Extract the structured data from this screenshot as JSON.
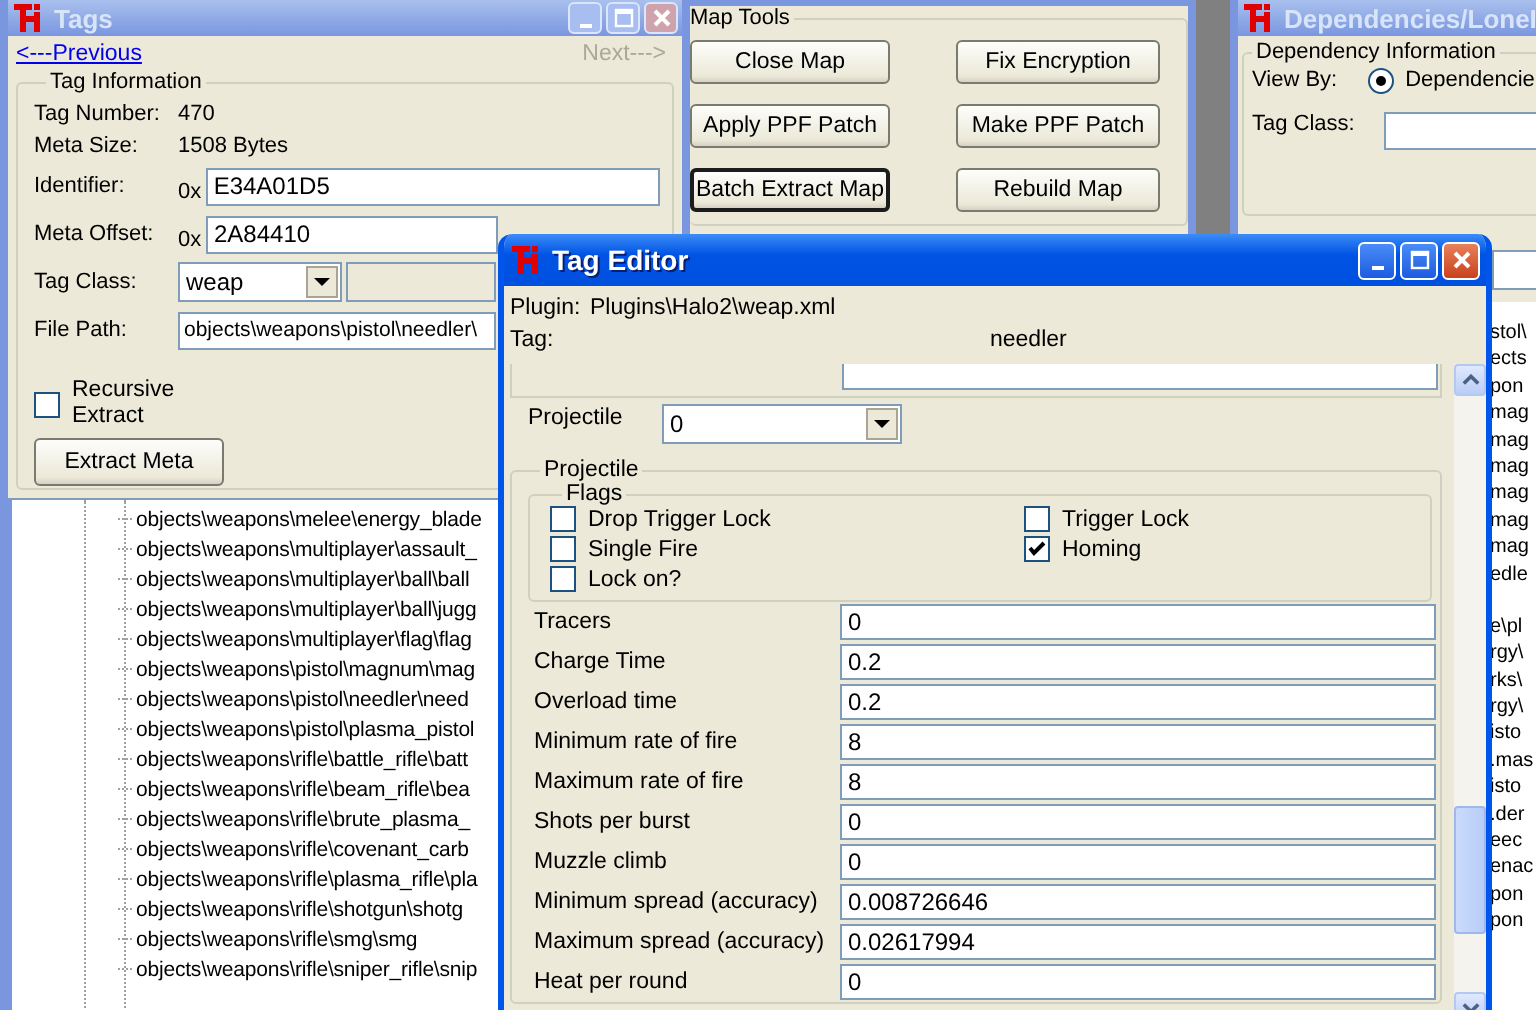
{
  "tags_window": {
    "title": "Tags",
    "previous_link": {
      "label": "<---Previous",
      "disabled": false
    },
    "next_link": {
      "label": "Next--->",
      "disabled": true
    },
    "group_title": "Tag Information",
    "info": [
      {
        "label": "Tag Number:",
        "value": "470"
      },
      {
        "label": "Meta Size:",
        "value": "1508 Bytes"
      }
    ],
    "identifier": {
      "label": "Identifier:",
      "prefix": "0x",
      "value": "E34A01D5"
    },
    "meta_offset": {
      "label": "Meta Offset:",
      "prefix": "0x",
      "value": "2A84410"
    },
    "tag_class": {
      "label": "Tag Class:",
      "value": "weap"
    },
    "file_path": {
      "label": "File Path:",
      "value": "objects\\weapons\\pistol\\needler\\"
    },
    "recursive_extract": {
      "label": "Recursive Extract",
      "checked": false
    },
    "extract_button": "Extract Meta",
    "tree_items": [
      "objects\\weapons\\melee\\energy_blade",
      "objects\\weapons\\multiplayer\\assault_",
      "objects\\weapons\\multiplayer\\ball\\ball",
      "objects\\weapons\\multiplayer\\ball\\jugg",
      "objects\\weapons\\multiplayer\\flag\\flag",
      "objects\\weapons\\pistol\\magnum\\mag",
      "objects\\weapons\\pistol\\needler\\need",
      "objects\\weapons\\pistol\\plasma_pistol",
      "objects\\weapons\\rifle\\battle_rifle\\batt",
      "objects\\weapons\\rifle\\beam_rifle\\bea",
      "objects\\weapons\\rifle\\brute_plasma_",
      "objects\\weapons\\rifle\\covenant_carb",
      "objects\\weapons\\rifle\\plasma_rifle\\pla",
      "objects\\weapons\\rifle\\shotgun\\shotg",
      "objects\\weapons\\rifle\\smg\\smg",
      "objects\\weapons\\rifle\\sniper_rifle\\snip"
    ]
  },
  "map_tools_window": {
    "group_title": "Map Tools",
    "buttons": [
      {
        "label": "Close Map",
        "focused": false
      },
      {
        "label": "Fix Encryption",
        "focused": false
      },
      {
        "label": "Apply PPF Patch",
        "focused": false
      },
      {
        "label": "Make PPF Patch",
        "focused": false
      },
      {
        "label": "Batch Extract Map",
        "focused": true
      },
      {
        "label": "Rebuild Map",
        "focused": false
      }
    ]
  },
  "dependencies_window": {
    "title": "Dependencies/LoneI",
    "group_title": "Dependency Information",
    "view_by_label": "View By:",
    "view_by_option": {
      "label": "Dependencie",
      "selected": true
    },
    "tag_class_label": "Tag Class:",
    "list_fragment_groups": [
      [
        "stol\\",
        "ects",
        "pon",
        "mag",
        "mag",
        "mag",
        "mag",
        "mag",
        "mag",
        "edle"
      ],
      [
        "e\\pl",
        "rgy\\",
        "rks\\",
        "rgy\\",
        "isto",
        ".mas",
        "isto",
        ".der",
        "eec",
        "enac",
        "pon",
        "pon"
      ]
    ]
  },
  "tag_editor": {
    "title": "Tag Editor",
    "plugin_label": "Plugin:",
    "plugin": "Plugins\\Halo2\\weap.xml",
    "tag_label": "Tag:",
    "tag": "needler",
    "projectile_label": "Projectile",
    "projectile_index": "0",
    "group_title": "Projectile",
    "flags_title": "Flags",
    "flags": [
      {
        "label": "Drop Trigger Lock",
        "checked": false
      },
      {
        "label": "Trigger Lock",
        "checked": false
      },
      {
        "label": "Single Fire",
        "checked": false
      },
      {
        "label": "Homing",
        "checked": true
      },
      {
        "label": "Lock on?",
        "checked": false
      }
    ],
    "fields": [
      {
        "label": "Tracers",
        "value": "0"
      },
      {
        "label": "Charge Time",
        "value": "0.2"
      },
      {
        "label": "Overload time",
        "value": "0.2"
      },
      {
        "label": "Minimum rate of fire",
        "value": "8"
      },
      {
        "label": "Maximum rate of fire",
        "value": "8"
      },
      {
        "label": "Shots per burst",
        "value": "0"
      },
      {
        "label": "Muzzle climb",
        "value": "0"
      },
      {
        "label": "Minimum spread (accuracy)",
        "value": "0.008726646"
      },
      {
        "label": "Maximum spread (accuracy)",
        "value": "0.02617994"
      },
      {
        "label": "Heat per round",
        "value": "0"
      }
    ]
  }
}
